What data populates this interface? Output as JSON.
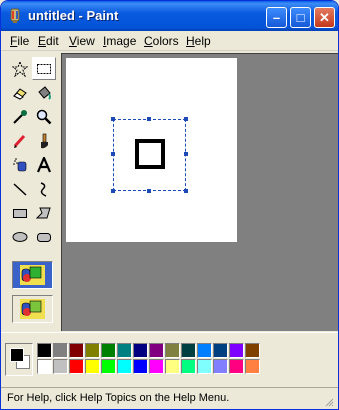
{
  "window": {
    "title": "untitled - Paint",
    "controls": {
      "minimize": "–",
      "maximize": "□",
      "close": "✕"
    }
  },
  "menubar": {
    "items": [
      {
        "label": "File",
        "accesskey": "F"
      },
      {
        "label": "Edit",
        "accesskey": "E"
      },
      {
        "label": "View",
        "accesskey": "V"
      },
      {
        "label": "Image",
        "accesskey": "I"
      },
      {
        "label": "Colors",
        "accesskey": "C"
      },
      {
        "label": "Help",
        "accesskey": "H"
      }
    ]
  },
  "toolbox": {
    "tools": [
      {
        "name": "free-form-select",
        "icon": "star-select-icon",
        "selected": false
      },
      {
        "name": "select",
        "icon": "rect-select-icon",
        "selected": true
      },
      {
        "name": "eraser",
        "icon": "eraser-icon",
        "selected": false
      },
      {
        "name": "fill",
        "icon": "paint-bucket-icon",
        "selected": false
      },
      {
        "name": "pick-color",
        "icon": "eyedropper-icon",
        "selected": false
      },
      {
        "name": "magnifier",
        "icon": "magnifier-icon",
        "selected": false
      },
      {
        "name": "pencil",
        "icon": "pencil-icon",
        "selected": false
      },
      {
        "name": "brush",
        "icon": "brush-icon",
        "selected": false
      },
      {
        "name": "airbrush",
        "icon": "airbrush-icon",
        "selected": false
      },
      {
        "name": "text",
        "icon": "text-a-icon",
        "selected": false
      },
      {
        "name": "line",
        "icon": "line-icon",
        "selected": false
      },
      {
        "name": "curve",
        "icon": "curve-icon",
        "selected": false
      },
      {
        "name": "rectangle",
        "icon": "rectangle-icon",
        "selected": false
      },
      {
        "name": "polygon",
        "icon": "polygon-icon",
        "selected": false
      },
      {
        "name": "ellipse",
        "icon": "ellipse-icon",
        "selected": false
      },
      {
        "name": "rounded-rectangle",
        "icon": "rounded-rect-icon",
        "selected": false
      }
    ],
    "options": [
      {
        "name": "opaque-selection",
        "icon": "opaque-option-icon",
        "selected": true
      },
      {
        "name": "transparent-selection",
        "icon": "transparent-option-icon",
        "selected": false
      }
    ]
  },
  "colors": {
    "foreground": "#000000",
    "background": "#ffffff",
    "palette_top": [
      "#000000",
      "#808080",
      "#800000",
      "#808000",
      "#008000",
      "#008080",
      "#000080",
      "#800080",
      "#808040",
      "#004040",
      "#0080ff",
      "#004080",
      "#8000ff",
      "#804000"
    ],
    "palette_bottom": [
      "#ffffff",
      "#c0c0c0",
      "#ff0000",
      "#ffff00",
      "#00ff00",
      "#00ffff",
      "#0000ff",
      "#ff00ff",
      "#ffff80",
      "#00ff80",
      "#80ffff",
      "#8080ff",
      "#ff0080",
      "#ff8040"
    ]
  },
  "statusbar": {
    "text": "For Help, click Help Topics on the Help Menu."
  }
}
